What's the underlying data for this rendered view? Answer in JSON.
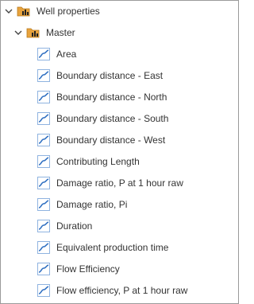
{
  "tree": {
    "root": {
      "label": "Well properties",
      "icon": "folder-with-bars-icon",
      "expanded": true
    },
    "group": {
      "label": "Master",
      "icon": "folder-with-bars-icon",
      "expanded": true
    },
    "items": [
      {
        "label": "Area",
        "icon": "curve-chart-icon"
      },
      {
        "label": "Boundary distance - East",
        "icon": "curve-chart-icon"
      },
      {
        "label": "Boundary distance - North",
        "icon": "curve-chart-icon"
      },
      {
        "label": "Boundary distance - South",
        "icon": "curve-chart-icon"
      },
      {
        "label": "Boundary distance - West",
        "icon": "curve-chart-icon"
      },
      {
        "label": "Contributing Length",
        "icon": "curve-chart-icon"
      },
      {
        "label": "Damage ratio, P at 1 hour raw",
        "icon": "curve-chart-icon"
      },
      {
        "label": "Damage ratio, Pi",
        "icon": "curve-chart-icon"
      },
      {
        "label": "Duration",
        "icon": "curve-chart-icon"
      },
      {
        "label": "Equivalent production time",
        "icon": "curve-chart-icon"
      },
      {
        "label": "Flow Efficiency",
        "icon": "curve-chart-icon"
      },
      {
        "label": "Flow efficiency, P at 1 hour raw",
        "icon": "curve-chart-icon"
      }
    ]
  },
  "colors": {
    "text": "#333333",
    "folder": "#e8a33d",
    "folder_bars": "#222222",
    "curve_icon": "#2f6fc1",
    "border": "#9a9a9a"
  }
}
